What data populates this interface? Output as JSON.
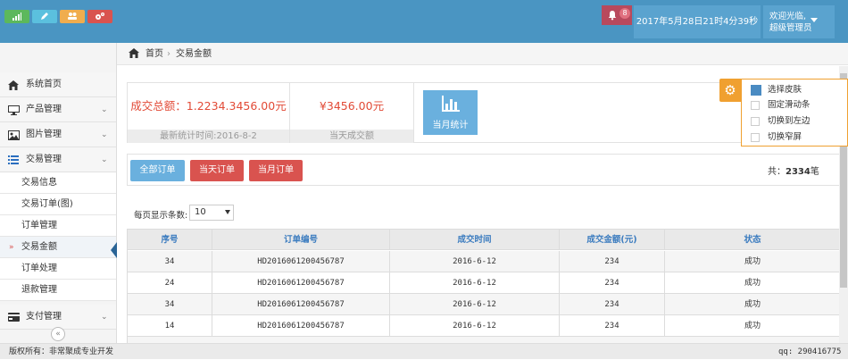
{
  "header": {
    "notification_count": "8",
    "datetime": "2017年5月28日21时4分39秒",
    "welcome": "欢迎光临,",
    "role": "超级管理员"
  },
  "sidebar": {
    "shortcuts": [
      {
        "icon": "signal-icon",
        "color": "#5cb85c"
      },
      {
        "icon": "pencil-icon",
        "color": "#5bc0de"
      },
      {
        "icon": "users-icon",
        "color": "#f0ad4e"
      },
      {
        "icon": "cogs-icon",
        "color": "#d9534f"
      }
    ],
    "items": [
      {
        "label": "系统首页",
        "icon": "home-icon"
      },
      {
        "label": "产品管理",
        "icon": "desktop-icon"
      },
      {
        "label": "图片管理",
        "icon": "picture-icon"
      },
      {
        "label": "交易管理",
        "icon": "list-icon"
      },
      {
        "label": "支付管理",
        "icon": "credit-card-icon"
      }
    ],
    "subitems": [
      {
        "label": "交易信息"
      },
      {
        "label": "交易订单(图)"
      },
      {
        "label": "订单管理"
      },
      {
        "label": "交易金额"
      },
      {
        "label": "订单处理"
      },
      {
        "label": "退款管理"
      }
    ],
    "active_marker": "»"
  },
  "breadcrumb": {
    "home": "首页",
    "sep": "›",
    "current": "交易金额"
  },
  "stats": {
    "total_label": "成交总额：1.2234.3456.00元",
    "total_caption": "最新统计时间:2016-8-2",
    "today_value": "¥3456.00元",
    "today_caption": "当天成交额",
    "monthly_label": "当月统计"
  },
  "filters": {
    "all": "全部订单",
    "today": "当天订单",
    "month": "当月订单",
    "total_prefix": "共：",
    "total_count": "2334",
    "total_suffix": "笔"
  },
  "pagesize": {
    "label": "每页显示条数:",
    "value": "10"
  },
  "table": {
    "headers": [
      "序号",
      "订单编号",
      "成交时间",
      "成交金额(元)",
      "状态"
    ],
    "rows": [
      [
        "34",
        "HD2016061200456787",
        "2016-6-12",
        "234",
        "成功"
      ],
      [
        "24",
        "HD2016061200456787",
        "2016-6-12",
        "234",
        "成功"
      ],
      [
        "34",
        "HD2016061200456787",
        "2016-6-12",
        "234",
        "成功"
      ],
      [
        "14",
        "HD2016061200456787",
        "2016-6-12",
        "234",
        "成功"
      ]
    ]
  },
  "skin_panel": {
    "options": [
      "选择皮肤",
      "固定滑动条",
      "切换到左边",
      "切换窄屏"
    ]
  },
  "footer": {
    "copyright": "版权所有：非常聚成专业开发",
    "contact": "qq: 290416775"
  }
}
